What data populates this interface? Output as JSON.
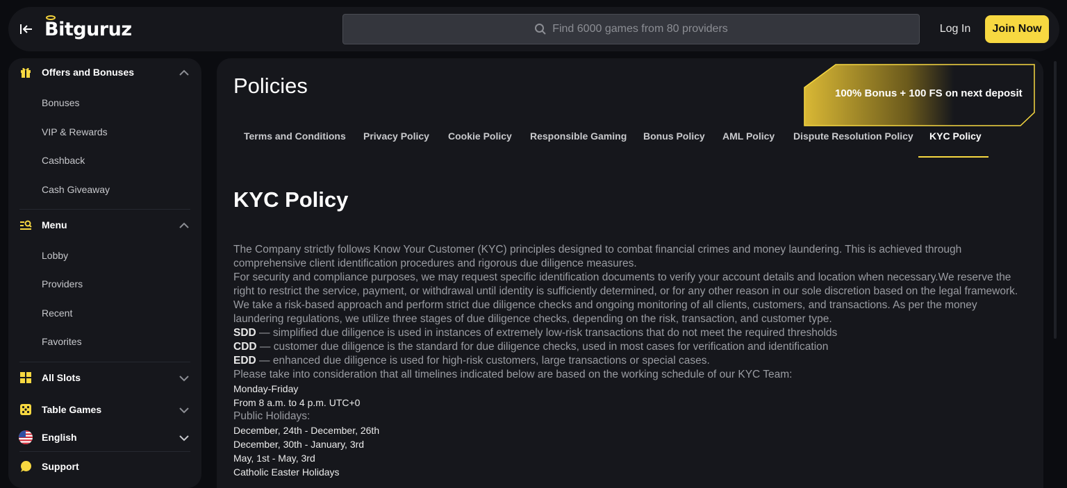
{
  "header": {
    "brand": "Bitguruz",
    "search_placeholder": "Find 6000 games from 80 providers",
    "login_label": "Log In",
    "join_label": "Join Now"
  },
  "sidebar": {
    "offers": {
      "label": "Offers and Bonuses",
      "items": [
        "Bonuses",
        "VIP & Rewards",
        "Cashback",
        "Cash Giveaway"
      ]
    },
    "menu": {
      "label": "Menu",
      "items": [
        "Lobby",
        "Providers",
        "Recent",
        "Favorites"
      ]
    },
    "all_slots": "All Slots",
    "table_games": "Table Games",
    "language": "English",
    "support": "Support"
  },
  "main": {
    "title": "Policies",
    "promo": "100% Bonus + 100 FS on next deposit",
    "tabs": [
      "Terms and Conditions",
      "Privacy Policy",
      "Cookie Policy",
      "Responsible Gaming",
      "Bonus Policy",
      "AML Policy",
      "Dispute Resolution Policy",
      "KYC Policy"
    ],
    "active_tab": "KYC Policy",
    "doc_title": "KYC Policy",
    "paragraphs": {
      "p1": "The Company strictly follows Know Your Customer (KYC) principles designed to combat financial crimes and money laundering. This is achieved through comprehensive client identification procedures and rigorous due diligence measures.",
      "p2": "For security and compliance purposes, we may request specific identification documents to verify your account details and location when necessary.We reserve the right to restrict the service, payment, or withdrawal until identity is sufficiently determined, or for any other reason in our sole discretion based on the legal framework.",
      "p3": "We take a risk-based approach and perform strict due diligence checks and ongoing monitoring of all clients, customers, and transactions. As per the money laundering regulations, we utilize three stages of due diligence checks, depending on the risk, transaction, and customer type.",
      "sdd_term": "SDD",
      "sdd_text": " — simplified due diligence is used in instances of extremely low-risk transactions that do not meet the required thresholds",
      "cdd_term": "CDD",
      "cdd_text": " — customer due diligence is the standard for due diligence checks, used in most cases for verification and identification",
      "edd_term": "EDD",
      "edd_text": " — enhanced due diligence is used for high-risk customers, large transactions or special cases.",
      "p4": "Please take into consideration that all timelines indicated below are based on the working schedule of our KYC Team:",
      "days": "Monday-Friday",
      "hours": "From 8 a.m. to 4 p.m. UTC+0",
      "holidays_label": "Public Holidays:",
      "holiday1": "December, 24th - December, 26th",
      "holiday2": "December, 30th - January, 3rd",
      "holiday3": "May, 1st - May, 3rd",
      "holiday4": "Catholic Easter Holidays"
    }
  },
  "colors": {
    "accent": "#f7d841",
    "background": "#0b0c10",
    "panel": "#16171c"
  }
}
